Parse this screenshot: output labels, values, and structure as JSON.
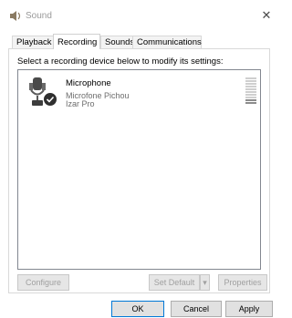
{
  "window": {
    "title": "Sound",
    "close_glyph": "✕"
  },
  "tabs": [
    {
      "label": "Playback"
    },
    {
      "label": "Recording"
    },
    {
      "label": "Sounds"
    },
    {
      "label": "Communications"
    }
  ],
  "active_tab": "Recording",
  "panel": {
    "instructions": "Select a recording device below to modify its settings:"
  },
  "devices": [
    {
      "name": "Microphone",
      "description_line1": "Microfone Pichou",
      "description_line2": "Izar Pro",
      "icon": "microphone-icon",
      "status_icon": "default-check-icon",
      "level_fraction": 0.2
    }
  ],
  "panel_buttons": {
    "configure": "Configure",
    "set_default": "Set Default",
    "dropdown_glyph": "▾",
    "properties": "Properties"
  },
  "dialog_buttons": {
    "ok": "OK",
    "cancel": "Cancel",
    "apply": "Apply"
  },
  "colors": {
    "accent": "#0078d7",
    "status_check": "#2f2f2f"
  }
}
